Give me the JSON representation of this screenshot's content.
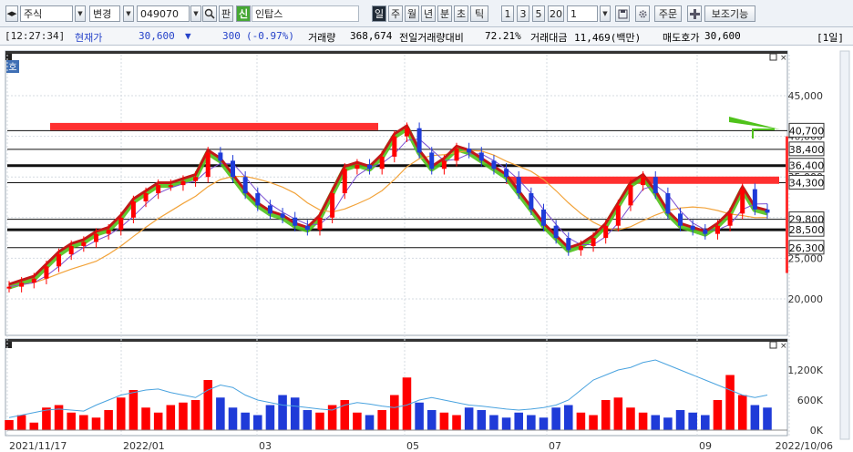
{
  "toolbar": {
    "market": "주식",
    "change_label": "변경",
    "code": "049070",
    "search_icon": "magnifier-icon",
    "pan_label": "판",
    "shin_label": "신",
    "stock_name": "인탑스",
    "periods": [
      "일",
      "주",
      "월",
      "년",
      "분",
      "초",
      "틱"
    ],
    "intervals": [
      "1",
      "3",
      "5",
      "20"
    ],
    "interval_value": "1",
    "order_label": "주문",
    "aux_label": "보조기능"
  },
  "quote": {
    "time": "[12:27:34]",
    "price_label": "현재가",
    "price": "30,600",
    "arrow": "▼",
    "change": "300",
    "change_pct": "(-0.97%)",
    "volume_label": "거래량",
    "volume": "368,674",
    "prev_ratio_label": "전일거래량대비",
    "prev_ratio": "72.21%",
    "amount_label": "거래대금",
    "amount": "11,469(백만)",
    "ask_label": "매도호가",
    "ask": "30,600",
    "period_tag": "[1일]"
  },
  "panel_tag": "호",
  "chart_data": {
    "type": "candlestick",
    "y_ticks": [
      "45,000",
      "40,000",
      "35,000",
      "30,000",
      "25,000",
      "20,000"
    ],
    "price_boxes": [
      "40,700",
      "38,400",
      "36,400",
      "34,300",
      "29,800",
      "28,500",
      "26,300"
    ],
    "volume_ticks": [
      "1,200K",
      "600K",
      "0K"
    ],
    "x_labels": [
      "2021/11/17",
      "2022/01",
      "03",
      "05",
      "07",
      "09",
      "2022/10/06"
    ],
    "close_path": [
      21500,
      22000,
      22500,
      24000,
      25500,
      26500,
      27000,
      28000,
      28500,
      30000,
      32000,
      33000,
      34000,
      34000,
      34500,
      35000,
      38000,
      37000,
      35000,
      33000,
      31500,
      30500,
      30000,
      29000,
      28500,
      30000,
      33000,
      36000,
      36500,
      36000,
      37500,
      40000,
      41000,
      38000,
      36000,
      37000,
      38500,
      38000,
      37000,
      36000,
      35000,
      33000,
      31000,
      29000,
      27500,
      26000,
      26500,
      27500,
      29000,
      31500,
      34000,
      35000,
      33000,
      30500,
      29000,
      28500,
      28000,
      29000,
      30500,
      33500,
      31000,
      30600
    ],
    "volume_path": [
      200,
      300,
      150,
      450,
      500,
      350,
      300,
      250,
      400,
      650,
      800,
      450,
      350,
      500,
      550,
      600,
      1000,
      650,
      450,
      350,
      300,
      500,
      700,
      650,
      400,
      350,
      500,
      600,
      350,
      300,
      400,
      700,
      1050,
      550,
      400,
      350,
      300,
      450,
      400,
      300,
      250,
      350,
      300,
      250,
      450,
      500,
      350,
      300,
      600,
      650,
      450,
      350,
      300,
      250,
      400,
      350,
      300,
      600,
      1100,
      700,
      500,
      450
    ],
    "avg_volume_path": [
      250,
      300,
      350,
      400,
      420,
      400,
      380,
      500,
      600,
      700,
      750,
      800,
      820,
      750,
      700,
      650,
      800,
      900,
      850,
      700,
      600,
      550,
      500,
      480,
      450,
      420,
      400,
      500,
      550,
      520,
      480,
      450,
      500,
      600,
      650,
      600,
      550,
      500,
      480,
      450,
      420,
      400,
      420,
      450,
      500,
      600,
      800,
      1000,
      1100,
      1200,
      1250,
      1350,
      1400,
      1300,
      1200,
      1100,
      1000,
      900,
      800,
      700,
      650,
      700
    ],
    "colors": {
      "up": "#ff0000",
      "down": "#1f3bd8",
      "trend_green": "#4fc21b",
      "resistance": "#ff3030",
      "ma_orange": "#f2a33a",
      "vol_line": "#4aa3df"
    }
  }
}
